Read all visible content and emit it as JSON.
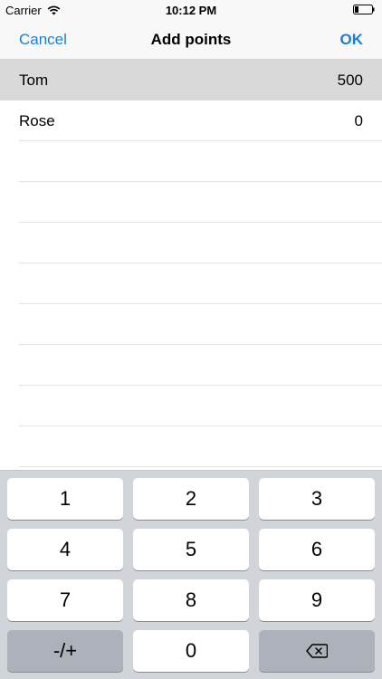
{
  "status_bar": {
    "carrier": "Carrier",
    "time": "10:12 PM"
  },
  "nav": {
    "cancel_label": "Cancel",
    "title": "Add points",
    "ok_label": "OK"
  },
  "players": [
    {
      "name": "Tom",
      "points": "500",
      "selected": true
    },
    {
      "name": "Rose",
      "points": "0",
      "selected": false
    }
  ],
  "keypad": {
    "keys": [
      "1",
      "2",
      "3",
      "4",
      "5",
      "6",
      "7",
      "8",
      "9",
      "-/+",
      "0"
    ],
    "backspace_icon": "backspace-icon"
  },
  "colors": {
    "accent": "#1a7fd4",
    "selected_row": "#d9d9d9",
    "keypad_bg": "#d1d4d9"
  }
}
